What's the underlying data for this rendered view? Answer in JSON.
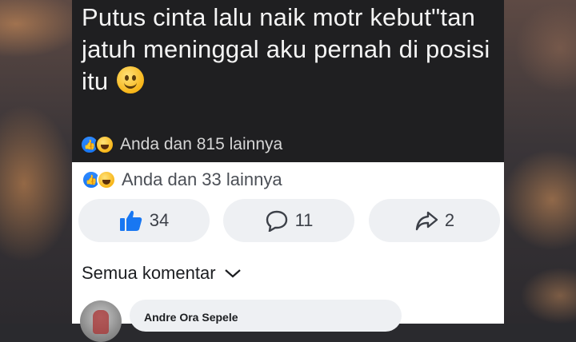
{
  "post": {
    "text": "Putus cinta lalu naik motr kebut\"tan jatuh meninggal aku pernah di posisi itu",
    "emoji": "slightly-smiling-face"
  },
  "reactions_top": {
    "text": "Anda dan 815 lainnya"
  },
  "reactions_bottom": {
    "text": "Anda dan 33 lainnya"
  },
  "actions": {
    "like_count": "34",
    "comment_count": "11",
    "share_count": "2"
  },
  "comments": {
    "filter_label": "Semua komentar",
    "first": {
      "author": "Andre Ora Sepele"
    }
  },
  "colors": {
    "like_blue": "#1877f2",
    "dark_bg": "#1f1f21",
    "pill_bg": "#eef0f3"
  }
}
